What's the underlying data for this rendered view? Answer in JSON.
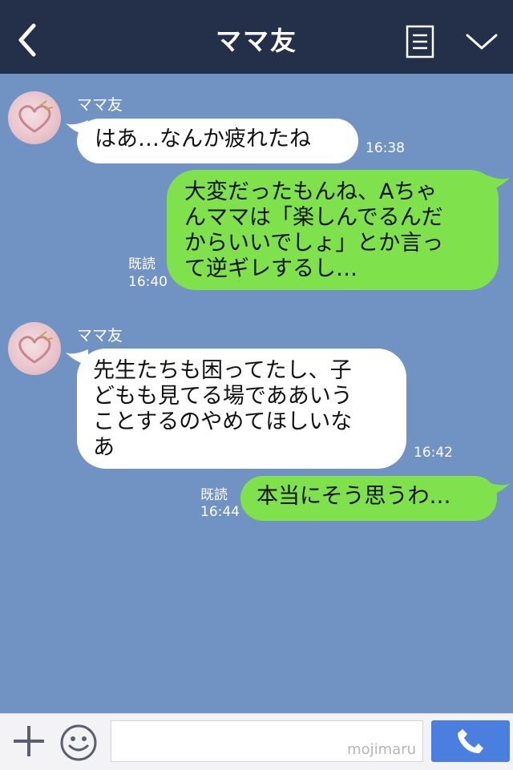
{
  "header": {
    "title": "ママ友"
  },
  "messages": [
    {
      "sender": "ママ友",
      "text": "はあ…なんか疲れたね",
      "time": "16:38"
    },
    {
      "read": "既読",
      "text": "大変だったもんね、Aちゃんママは「楽しんでるんだからいいでしょ」とか言って逆ギレするし…",
      "lines": [
        "大変だったもんね、Aちゃ",
        "んママは「楽しんでるんだ",
        "からいいでしょ」とか言っ",
        "て逆ギレするし…"
      ],
      "time": "16:40"
    },
    {
      "sender": "ママ友",
      "text": "先生たちも困ってたし、子どもも見てる場であああいうことするのやめてほしいなあ",
      "lines": [
        "先生たちも困ってたし、子",
        "どもも見てる場でああいう",
        "ことするのやめてほしいな",
        "あ"
      ],
      "time": "16:42"
    },
    {
      "read": "既読",
      "text": "本当にそう思うわ…",
      "time": "16:44"
    }
  ],
  "input": {
    "watermark": "mojimaru"
  },
  "colors": {
    "header": "#243049",
    "background": "#7193c4",
    "outgoing": "#7fe14c",
    "incoming": "#ffffff",
    "call": "#4a7fe0"
  },
  "icons": [
    "back-arrow-icon",
    "memo-icon",
    "chevron-down-icon",
    "plus-icon",
    "smile-icon",
    "phone-icon"
  ]
}
